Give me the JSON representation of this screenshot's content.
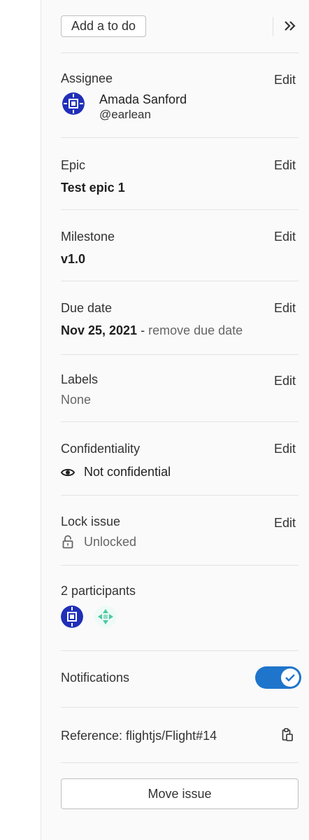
{
  "todo": {
    "add_label": "Add a to do",
    "collapse_icon": "double-chevron-right-icon"
  },
  "assignee": {
    "title": "Assignee",
    "edit": "Edit",
    "name": "Amada Sanford",
    "username": "@earlean"
  },
  "epic": {
    "title": "Epic",
    "edit": "Edit",
    "value": "Test epic 1"
  },
  "milestone": {
    "title": "Milestone",
    "edit": "Edit",
    "value": "v1.0"
  },
  "due_date": {
    "title": "Due date",
    "edit": "Edit",
    "value": "Nov 25, 2021",
    "separator": "-",
    "remove_label": "remove due date"
  },
  "labels": {
    "title": "Labels",
    "edit": "Edit",
    "value": "None"
  },
  "confidentiality": {
    "title": "Confidentiality",
    "edit": "Edit",
    "value": "Not confidential",
    "icon": "eye-icon"
  },
  "lock": {
    "title": "Lock issue",
    "edit": "Edit",
    "value": "Unlocked",
    "icon": "lock-open-icon"
  },
  "participants": {
    "title": "2 participants"
  },
  "notifications": {
    "title": "Notifications",
    "enabled": true
  },
  "reference": {
    "label": "Reference: flightjs/Flight#14",
    "icon": "copy-icon"
  },
  "move": {
    "label": "Move issue"
  },
  "colors": {
    "toggle": "#1f75cb",
    "avatar_primary": "#1f2fb8",
    "avatar_secondary": "#4cc9a3"
  }
}
